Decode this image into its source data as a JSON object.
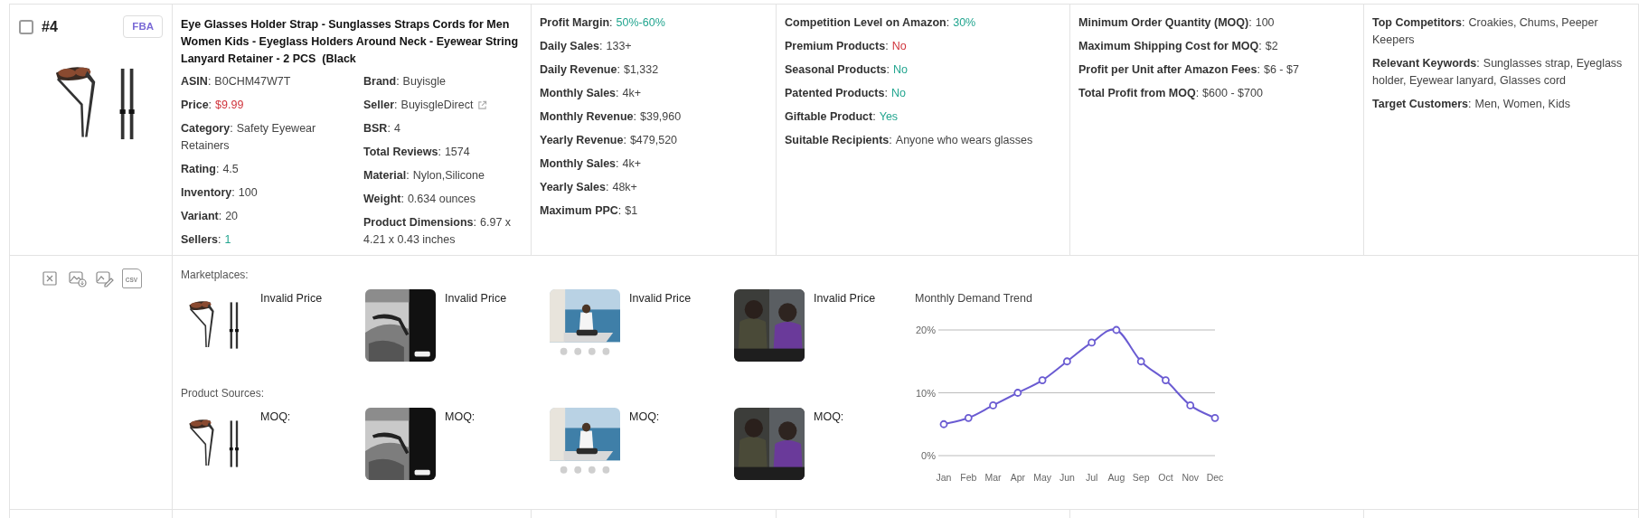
{
  "product": {
    "checked": false,
    "rank": "#4",
    "badge": "FBA",
    "title": "Eye Glasses Holder Strap - Sunglasses Straps Cords for Men Women Kids - Eyeglass Holders Around Neck - Eyewear String Lanyard Retainer - 2 PCS  (Black",
    "details_left": [
      {
        "label": "**ASIN**:",
        "value": "B0CHM47W7T"
      },
      {
        "label": "**Price**:",
        "value": "$9.99",
        "color": "#d0343c"
      },
      {
        "label": "**Category**:",
        "value": "Safety Eyewear Retainers"
      },
      {
        "label": "**Rating**:",
        "value": "4.5"
      },
      {
        "label": "**Inventory**:",
        "value": "100"
      },
      {
        "label": "**Variant**:",
        "value": "20"
      },
      {
        "label": "**Sellers**:",
        "value": "1",
        "color": "#22a58f"
      }
    ],
    "details_right": [
      {
        "label": "**Brand**:",
        "value": "Buyisgle",
        "link": false
      },
      {
        "label": "**Seller**:",
        "value": "BuyisgleDirect",
        "link": true
      },
      {
        "label": "**BSR**:",
        "value": "4",
        "link": false
      },
      {
        "label": "**Total Reviews**:",
        "value": "1574",
        "link": false
      },
      {
        "label": "**Material**:",
        "value": "Nylon,Silicone",
        "link": false
      },
      {
        "label": "**Weight**:",
        "value": "0.634 ounces",
        "link": false
      },
      {
        "label": "**Product Dimensions**:",
        "value": "6.97 x 4.21 x 0.43 inches",
        "link": false
      }
    ]
  },
  "info_columns": [
    [
      {
        "label": "**Profit Margin**:",
        "value": "50%-60%",
        "color": "#22a58f"
      },
      {
        "label": "**Daily Sales**:",
        "value": "133+"
      },
      {
        "label": "**Daily Revenue**:",
        "value": "$1,332"
      },
      {
        "label": "**Monthly Sales**:",
        "value": "4k+"
      },
      {
        "label": "**Monthly Revenue**:",
        "value": "$39,960"
      },
      {
        "label": "**Yearly Revenue**:",
        "value": "$479,520"
      },
      {
        "label": "**Monthly Sales**:",
        "value": "4k+"
      },
      {
        "label": "**Yearly Sales**:",
        "value": "48k+"
      },
      {
        "label": "**Maximum PPC**:",
        "value": "$1"
      }
    ],
    [
      {
        "label": "**Competition Level on Amazon**:",
        "value": "30%",
        "color": "#22a58f"
      },
      {
        "label": "**Premium Products**:",
        "value": "No",
        "color": "#d0343c"
      },
      {
        "label": "**Seasonal Products**:",
        "value": "No",
        "color": "#22a58f"
      },
      {
        "label": "**Patented Products**:",
        "value": "No",
        "color": "#22a58f"
      },
      {
        "label": "**Giftable Product**:",
        "value": "Yes",
        "color": "#22a58f"
      },
      {
        "label": "**Suitable Recipients**:",
        "value": "Anyone who wears glasses"
      }
    ],
    [
      {
        "label": "**Minimum Order Quantity (MOQ)**:",
        "value": "100"
      },
      {
        "label": "**Maximum Shipping Cost for MOQ**:",
        "value": "$2"
      },
      {
        "label": "**Profit per Unit after Amazon Fees**:",
        "value": "$6 - $7"
      },
      {
        "label": "**Total Profit from MOQ**:",
        "value": "$600 - $700"
      }
    ],
    [
      {
        "label": "**Top Competitors**:",
        "value": "Croakies, Chums, Peeper Keepers"
      },
      {
        "label": "**Relevant Keywords**:",
        "value": "Sunglasses strap, Eyeglass holder, Eyewear lanyard, Glasses cord"
      },
      {
        "label": "**Target Customers**:",
        "value": "Men, Women, Kids"
      }
    ]
  ],
  "actions": [
    {
      "kind": "remove"
    },
    {
      "kind": "image-download"
    },
    {
      "kind": "image-edit"
    },
    {
      "kind": "csv",
      "label": "CSV"
    }
  ],
  "marketplaces": {
    "heading": "Marketplaces:",
    "items": [
      {
        "note": "Invalid Price"
      },
      {
        "note": "Invalid Price"
      },
      {
        "note": "Invalid Price"
      },
      {
        "note": "Invalid Price"
      }
    ]
  },
  "sources": {
    "heading": "Product Sources:",
    "items": [
      {
        "note": "MOQ:"
      },
      {
        "note": "MOQ:"
      },
      {
        "note": "MOQ:"
      },
      {
        "note": "MOQ:"
      }
    ]
  },
  "chart_data": {
    "type": "line",
    "title": "Monthly Demand Trend",
    "categories": [
      "Jan",
      "Feb",
      "Mar",
      "Apr",
      "May",
      "Jun",
      "Jul",
      "Aug",
      "Sep",
      "Oct",
      "Nov",
      "Dec"
    ],
    "series": [
      {
        "color": "#6a5bd2",
        "marker": true,
        "values": [
          5,
          6,
          8,
          10,
          12,
          15,
          18,
          20,
          15,
          12,
          8,
          6
        ]
      }
    ],
    "ylim": [
      0,
      20
    ],
    "yticks": [
      {
        "value": 0,
        "label": "0%"
      },
      {
        "value": 10,
        "label": "10%"
      },
      {
        "value": 20,
        "label": "20%"
      }
    ]
  }
}
